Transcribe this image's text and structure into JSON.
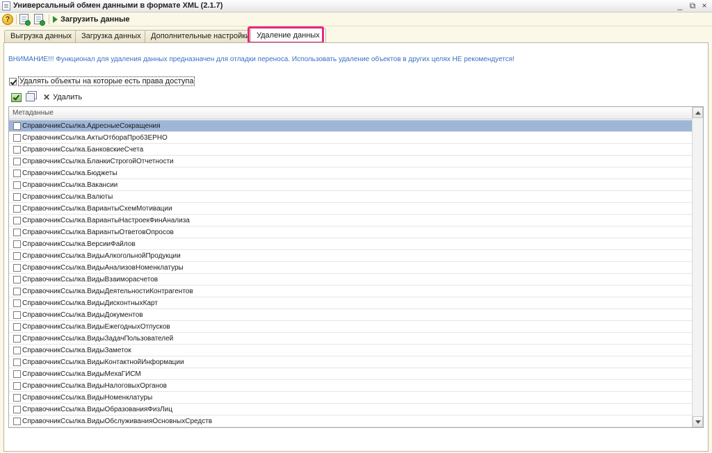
{
  "window": {
    "title": "Универсальный обмен данными в формате XML (2.1.7)",
    "minimize": "_",
    "restore": "⧉",
    "close": "×"
  },
  "toolbar": {
    "help_glyph": "?",
    "load_label": "Загрузить данные"
  },
  "tabs": [
    {
      "label": "Выгрузка данных"
    },
    {
      "label": "Загрузка данных"
    },
    {
      "label": "Дополнительные настройки"
    },
    {
      "label": "Удаление данных"
    }
  ],
  "active_tab": 3,
  "panel": {
    "warning": "ВНИМАНИЕ!!! Функционал для удаления данных предназначен для отладки переноса. Использовать удаление объектов в других целях НЕ рекомендуется!",
    "access_checkbox_label": "Удалять объекты на которые есть права доступа",
    "access_checkbox_checked": true,
    "delete_label": "Удалить",
    "delete_glyph": "✕"
  },
  "grid": {
    "column_header": "Метаданные",
    "selected_row": 0,
    "rows": [
      "СправочникСсылка.АдресныеСокращения",
      "СправочникСсылка.АктыОтбораПроб3ЕРНО",
      "СправочникСсылка.БанковскиеСчета",
      "СправочникСсылка.БланкиСтрогойОтчетности",
      "СправочникСсылка.Бюджеты",
      "СправочникСсылка.Вакансии",
      "СправочникСсылка.Валюты",
      "СправочникСсылка.ВариантыСхемМотивации",
      "СправочникСсылка.ВариантыНастроекФинАнализа",
      "СправочникСсылка.ВариантыОтветовОпросов",
      "СправочникСсылка.ВерсииФайлов",
      "СправочникСсылка.ВидыАлкогольнойПродукции",
      "СправочникСсылка.ВидыАнализовНоменклатуры",
      "СправочникСсылка.ВидыВзаиморасчетов",
      "СправочникСсылка.ВидыДеятельностиКонтрагентов",
      "СправочникСсылка.ВидыДисконтныхКарт",
      "СправочникСсылка.ВидыДокументов",
      "СправочникСсылка.ВидыЕжегодныхОтпусков",
      "СправочникСсылка.ВидыЗадачПользователей",
      "СправочникСсылка.ВидыЗаметок",
      "СправочникСсылка.ВидыКонтактнойИнформации",
      "СправочникСсылка.ВидыМехаГИСМ",
      "СправочникСсылка.ВидыНалоговыхОрганов",
      "СправочникСсылка.ВидыНоменклатуры",
      "СправочникСсылка.ВидыОбразованияФизЛиц",
      "СправочникСсылка.ВидыОбслуживанияОсновныхСредств"
    ]
  },
  "colors": {
    "background": "#fbf8e8",
    "warning_text": "#3a6fc4",
    "selected_row": "#9eb6d8",
    "tab_highlight": "#e3287e"
  }
}
